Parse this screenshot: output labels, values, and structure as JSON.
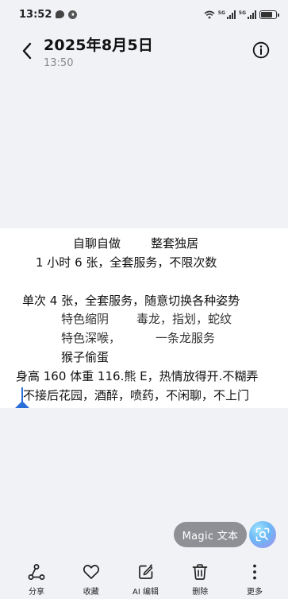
{
  "status_bar": {
    "time": "13:52",
    "network_label_1": "5G",
    "network_label_2": "5G"
  },
  "header": {
    "title": "2025年8月5日",
    "subtitle": "13:50"
  },
  "image_text": {
    "line1": "自聊自做        整套独居",
    "line2": "1 小时 6 张，全套服务，不限次数",
    "line3": "单次 4 张，全套服务，随意切换各种姿势",
    "line4a": "特色缩阴",
    "line4b": "毒龙，指划，蛇纹",
    "line5a": "特色深喉，",
    "line5b": "一条龙服务",
    "line6": "猴子偷蛋",
    "line7": "身高 160 体重 116.熊 E，热情放得开.不糊弄",
    "line8": "不接后花园，酒醉，喷药，不闲聊，不上门"
  },
  "magic": {
    "label": "Magic 文本"
  },
  "toolbar": {
    "share": "分享",
    "favorite": "收藏",
    "ai_edit": "AI 编辑",
    "delete": "删除",
    "more": "更多"
  },
  "colors": {
    "background": "#f1f2f6",
    "accent": "#2a6fd8",
    "pill": "#8f9096"
  }
}
